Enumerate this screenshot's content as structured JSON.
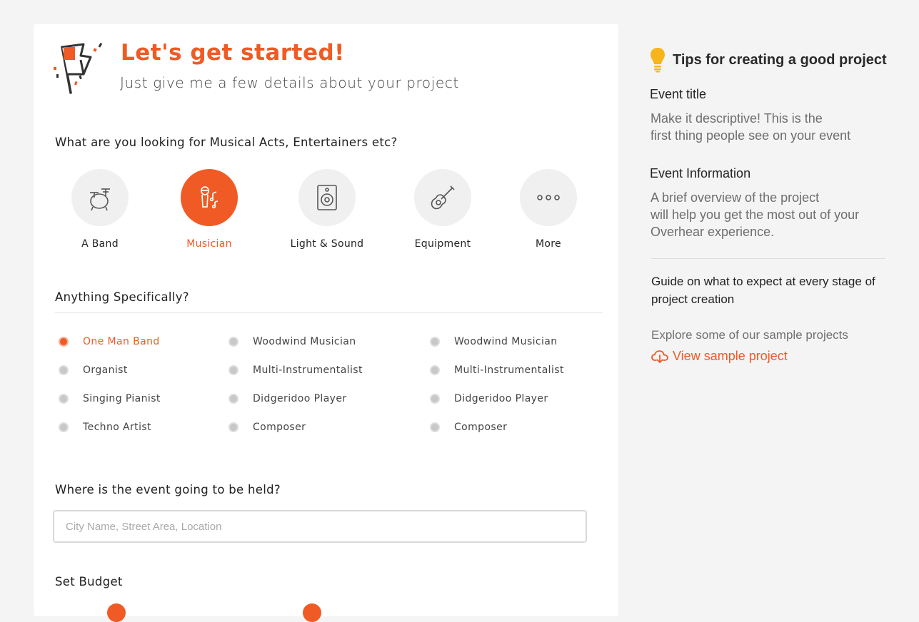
{
  "colors": {
    "accent": "#f05a24",
    "muted_circle": "#f0f0f0",
    "page_bg": "#f4f4f4"
  },
  "hero": {
    "title": "Let's get started!",
    "subtitle": "Just give me a few details about your project",
    "icon": "flag-icon"
  },
  "category_question": "What are you looking for Musical Acts, Entertainers etc?",
  "categories": [
    {
      "label": "A Band",
      "icon": "drum-kit-icon",
      "active": false
    },
    {
      "label": "Musician",
      "icon": "microphone-icon",
      "active": true
    },
    {
      "label": "Light & Sound",
      "icon": "speaker-icon",
      "active": false
    },
    {
      "label": "Equipment",
      "icon": "guitar-icon",
      "active": false
    },
    {
      "label": "More",
      "icon": "more-dots-icon",
      "active": false
    }
  ],
  "specific_question": "Anything Specifically?",
  "options": {
    "col1": [
      "One Man Band",
      "Organist",
      "Singing Pianist",
      "Techno Artist"
    ],
    "col2": [
      "Woodwind Musician",
      "Multi-Instrumentalist",
      "Didgeridoo Player",
      "Composer"
    ],
    "col3": [
      "Woodwind Musician",
      "Multi-Instrumentalist",
      "Didgeridoo Player",
      "Composer"
    ],
    "selected": "One Man Band"
  },
  "location": {
    "question": "Where is the event going to be held?",
    "placeholder": "City Name, Street Area, Location",
    "value": ""
  },
  "budget": {
    "label": "Set Budget"
  },
  "tips": {
    "icon": "lightbulb-icon",
    "title": "Tips for creating a good project",
    "event_title_heading": "Event title",
    "event_title_text": "Make it descriptive! This is the\nfirst thing people see on your event",
    "event_info_heading": "Event Information",
    "event_info_text": "A brief overview of the project\nwill help you get the most out of your\nOverhear experience.",
    "guide": "Guide on what to expect at every stage of project creation",
    "explore": "Explore some of our sample projects",
    "sample_link": "View sample project",
    "sample_icon": "cloud-download-icon"
  }
}
